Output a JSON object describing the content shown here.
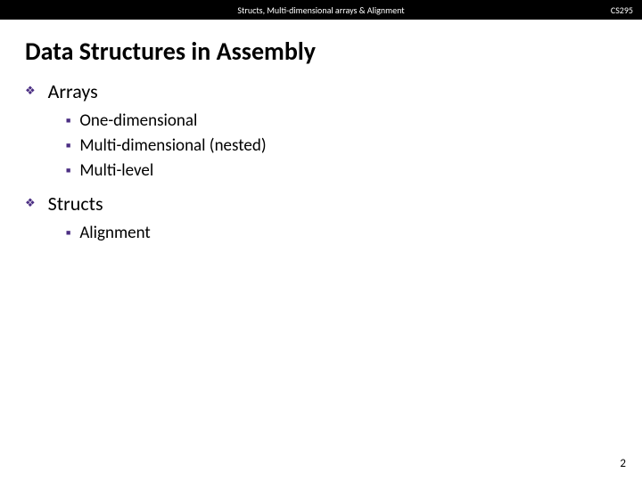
{
  "header": {
    "center": "Structs, Multi-dimensional arrays & Alignment",
    "right": "CS295"
  },
  "title": "Data Structures in Assembly",
  "sections": [
    {
      "label": "Arrays",
      "items": [
        {
          "text": "One-dimensional"
        },
        {
          "text": "Multi-dimensional (nested)"
        },
        {
          "text": "Multi-level"
        }
      ]
    },
    {
      "label": "Structs",
      "items": [
        {
          "text": "Alignment"
        }
      ]
    }
  ],
  "page_number": "2"
}
